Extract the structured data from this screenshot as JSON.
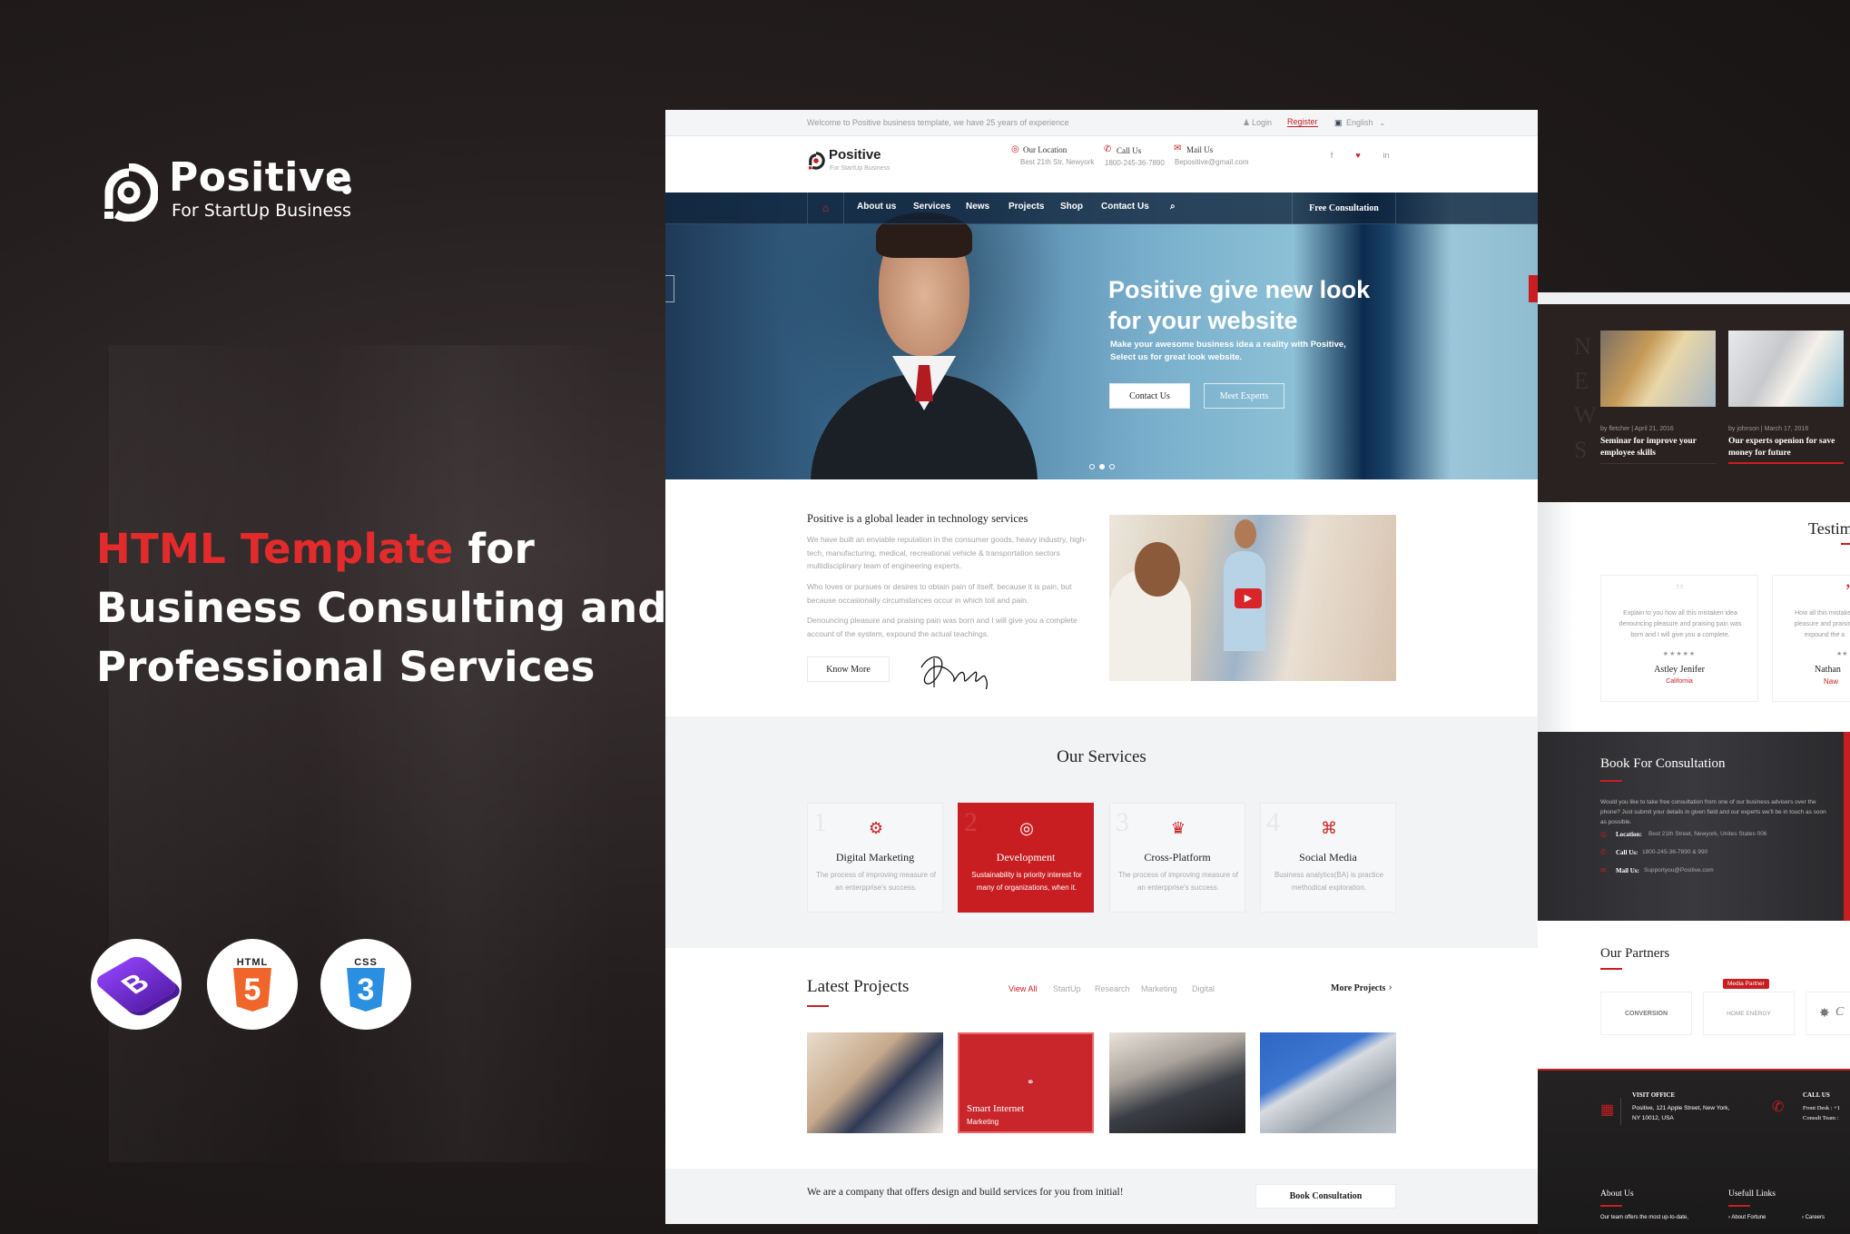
{
  "branding": {
    "name": "Positive",
    "tagline": "For StartUp Business",
    "headline_red": "HTML Template",
    "headline_rest": " for",
    "headline_line2": "Business Consulting and",
    "headline_line3": "Professional Services",
    "badges": [
      {
        "icon": "bootstrap-icon",
        "label": "B",
        "color": "#7b2fd6"
      },
      {
        "icon": "html5-icon",
        "label": "HTML",
        "glyph": "5",
        "color": "#ef652a"
      },
      {
        "icon": "css3-icon",
        "label": "CSS",
        "glyph": "3",
        "color": "#2a8fe0"
      }
    ]
  },
  "colors": {
    "accent": "#c81e22",
    "dark": "#2a2121",
    "nav": "#10223a"
  },
  "site": {
    "topbar": {
      "welcome": "Welcome to Positive business template, we have 25 years of experience",
      "login": "Login",
      "register": "Register",
      "language": "English"
    },
    "header": {
      "logo_name": "Positive",
      "logo_tagline": "For StartUp Business",
      "location_label": "Our Location",
      "location_value": "Best 21th Str, Newyork",
      "call_label": "Call Us",
      "call_value": "1800-245-36-7890",
      "mail_label": "Mail Us",
      "mail_value": "Bepositive@gmail.com",
      "social": [
        "f",
        "♥",
        "in"
      ]
    },
    "nav": {
      "items": [
        "About us",
        "Services",
        "News",
        "Projects",
        "Shop",
        "Contact Us"
      ],
      "cta": "Free Consultation"
    },
    "hero": {
      "title_line1": "Positive give new look",
      "title_line2": "for your website",
      "subtitle_line1": "Make your awesome business idea a reality with Positive,",
      "subtitle_line2": "Select us for great look website.",
      "primary_button": "Contact Us",
      "secondary_button": "Meet Experts",
      "active_slide": 2,
      "slide_count": 3
    },
    "about": {
      "title": "Positive is a global leader in technology services",
      "paragraphs": [
        "We have built an enviable reputation in the consumer goods, heavy industry, high-tech, manufacturing, medical, recreational vehicle & transportation sectors multidisciplinary team of engineering experts.",
        "Who loves or pursues or desires to obtain pain of itself, because it is pain, but because occasionally circumstances occur in which toil and pain.",
        "Denouncing pleasure and praising pain was born and I will give you a complete account of the system, expound the actual teachings."
      ],
      "button": "Know More"
    },
    "services": {
      "title": "Our Services",
      "items": [
        {
          "num": "1",
          "title": "Digital Marketing",
          "desc": "The process of improving measure of an enterpprise's success.",
          "icon": "gear-badge-icon"
        },
        {
          "num": "2",
          "title": "Development",
          "desc": "Sustainability is priority interest for many of organizations, when it.",
          "icon": "target-icon"
        },
        {
          "num": "3",
          "title": "Cross-Platform",
          "desc": "The process of improving measure of an enterpprise's success.",
          "icon": "trophy-icon"
        },
        {
          "num": "4",
          "title": "Social Media",
          "desc": "Business analytics(BA) is practice methodical exploration.",
          "icon": "network-icon"
        }
      ]
    },
    "projects": {
      "title": "Latest Projects",
      "filters": [
        "View All",
        "StartUp",
        "Research",
        "Marketing",
        "Digital"
      ],
      "more": "More Projects",
      "featured_title": "Smart Internet",
      "featured_category": "Marketing"
    },
    "cta": {
      "text": "We are a company that offers design and build services for you from initial!",
      "button": "Book Consultation"
    }
  },
  "side": {
    "news_letters": [
      "N",
      "E",
      "W",
      "S"
    ],
    "news": [
      {
        "author": "by fletcher",
        "date": "April 21, 2016",
        "title": "Seminar for improve your employee skills"
      },
      {
        "author": "by johnson",
        "date": "March 17, 2016",
        "title": "Our experts openion for save money for future"
      }
    ],
    "testimonials": {
      "title": "Testim",
      "items": [
        {
          "text": "Explain to you how all this mistaken idea denouncing pleasure and praising pain was born and I will give you a complete.",
          "name": "Astley Jenifer",
          "place": "California",
          "stars": "★★★★★"
        },
        {
          "text": "How all this mistaken pleasure and praising expound the a",
          "name": "Nathan",
          "place": "Naw",
          "stars": "★★"
        }
      ]
    },
    "book": {
      "title": "Book For Consultation",
      "text": "Would you like to take free consultation from one of our business advisers over the phone? Just submit your details in given field and our experts we'll be in touch as soon as possible.",
      "location_label": "Location:",
      "location_value": "Best 21th Street, Newyork, Unites States 006",
      "call_label": "Call Us:",
      "call_value": "1800-245-36-7890 & 990",
      "mail_label": "Mail Us:",
      "mail_value": "Supportyou@Positive.com"
    },
    "partners": {
      "title": "Our Partners",
      "tag": "Media Partner",
      "logos": [
        "CONVERSION",
        "HOME ENERGY",
        "C"
      ]
    },
    "footer": {
      "visit_title": "VISIT OFFICE",
      "visit_line1": "Positive, 121 Apple Street, New York,",
      "visit_line2": "NY 10012, USA",
      "call_title": "CALL US",
      "call_line1": "Front Desk : +1",
      "call_line2": "Consult Team :",
      "about_title": "About Us",
      "about_text": "Our team offers the most up-to-date,",
      "links_title": "Usefull Links",
      "links": [
        "About Fortune",
        "Careers"
      ]
    }
  }
}
